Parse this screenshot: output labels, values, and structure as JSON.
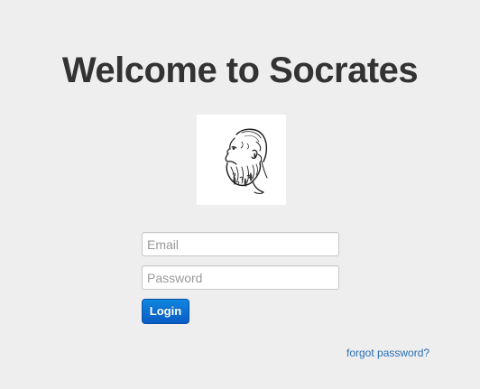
{
  "page": {
    "title": "Welcome to Socrates"
  },
  "logo": {
    "icon": "socrates-bust-icon"
  },
  "form": {
    "email_placeholder": "Email",
    "email_value": "",
    "password_placeholder": "Password",
    "password_value": "",
    "login_label": "Login"
  },
  "links": {
    "forgot_password": "forgot password?"
  },
  "colors": {
    "background": "#eeeeee",
    "title": "#333333",
    "button": "#0a6fd6",
    "link": "#2a6eb7"
  }
}
